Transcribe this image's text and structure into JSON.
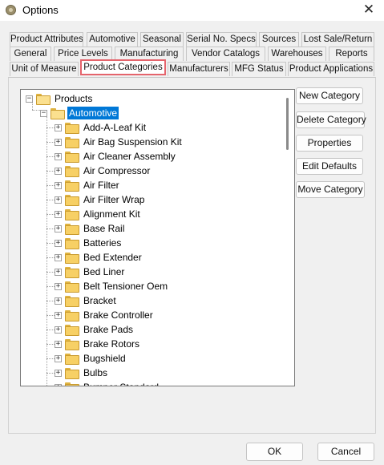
{
  "window": {
    "title": "Options",
    "close_glyph": "✕"
  },
  "tabs": {
    "row1": [
      "Product Attributes",
      "Automotive",
      "Seasonal",
      "Serial No. Specs",
      "Sources",
      "Lost Sale/Return"
    ],
    "row2": [
      "General",
      "Price Levels",
      "Manufacturing",
      "Vendor Catalogs",
      "Warehouses",
      "Reports"
    ],
    "row3": [
      "Unit of Measure",
      "Product Categories",
      "Manufacturers",
      "MFG Status",
      "Product Applications"
    ],
    "active": "Product Categories",
    "active_outline_color": "#e5646c"
  },
  "tree": {
    "root": "Products",
    "selected": "Automotive",
    "children": [
      "Add-A-Leaf Kit",
      "Air Bag Suspension Kit",
      "Air Cleaner Assembly",
      "Air Compressor",
      "Air Filter",
      "Air Filter Wrap",
      "Alignment Kit",
      "Base Rail",
      "Batteries",
      "Bed Extender",
      "Bed Liner",
      "Belt Tensioner Oem",
      "Bracket",
      "Brake Controller",
      "Brake Pads",
      "Brake Rotors",
      "Bugshield",
      "Bulbs",
      "Bumper Standard"
    ],
    "expand_glyph": "+",
    "collapse_glyph": "−",
    "selection_color": "#0078d7"
  },
  "side_buttons": {
    "new_category": "New Category",
    "delete_category": "Delete Category",
    "properties": "Properties",
    "edit_defaults": "Edit Defaults",
    "move_category": "Move Category"
  },
  "footer": {
    "ok": "OK",
    "cancel": "Cancel"
  }
}
